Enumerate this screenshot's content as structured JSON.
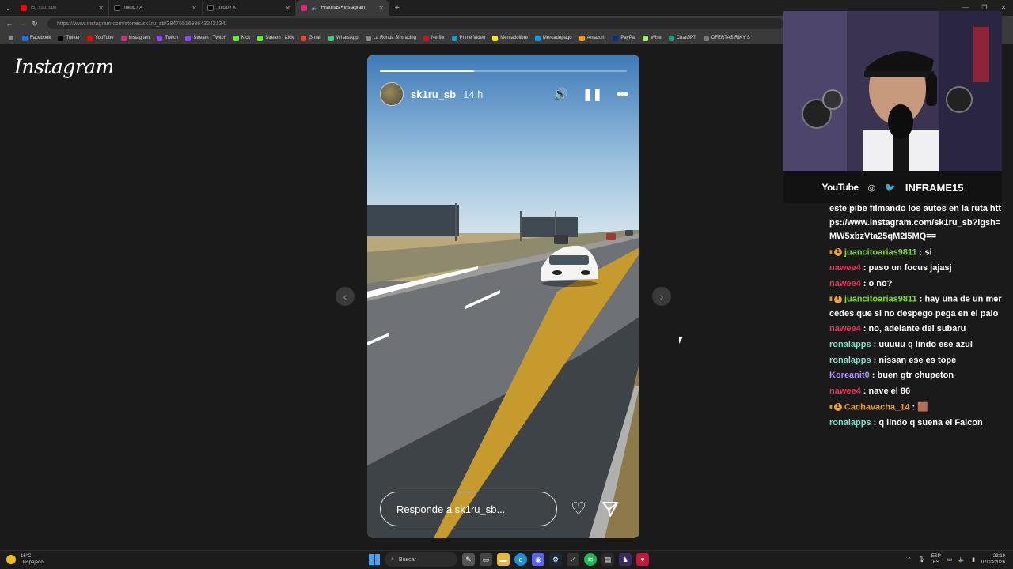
{
  "browser": {
    "tabs": [
      {
        "label": "(5) YouTube",
        "color": "#ff0000",
        "active": false
      },
      {
        "label": "Inicio / X",
        "color": "#000000",
        "active": false
      },
      {
        "label": "Inicio / X",
        "color": "#000000",
        "active": false
      },
      {
        "label": "Historias • Instagram",
        "color": "#d62976",
        "active": true
      }
    ],
    "url": "https://www.instagram.com/stories/sk1ru_sb/3847551693643242134/",
    "bookmarks": [
      {
        "label": "Facebook",
        "color": "#1877f2"
      },
      {
        "label": "Twitter",
        "color": "#000000"
      },
      {
        "label": "YouTube",
        "color": "#ff0000"
      },
      {
        "label": "Instagram",
        "color": "#d62976"
      },
      {
        "label": "Twitch",
        "color": "#9146ff"
      },
      {
        "label": "Stream - Twitch",
        "color": "#9146ff"
      },
      {
        "label": "Kick",
        "color": "#53fc18"
      },
      {
        "label": "Stream - Kick",
        "color": "#53fc18"
      },
      {
        "label": "Gmail",
        "color": "#ea4335"
      },
      {
        "label": "WhatsApp",
        "color": "#25d366"
      },
      {
        "label": "La Ronda Simracing",
        "color": "#888888"
      },
      {
        "label": "Netflix",
        "color": "#e50914"
      },
      {
        "label": "Prime Video",
        "color": "#00a8e1"
      },
      {
        "label": "Mercadolibre",
        "color": "#ffe600"
      },
      {
        "label": "Mercadopago",
        "color": "#009ee3"
      },
      {
        "label": "Amazon.",
        "color": "#ff9900"
      },
      {
        "label": "PayPal",
        "color": "#003087"
      },
      {
        "label": "Wise",
        "color": "#9fe870"
      },
      {
        "label": "ChatGPT",
        "color": "#10a37f"
      },
      {
        "label": "OFERTAS RIKY S",
        "color": "#777777"
      }
    ]
  },
  "instagram": {
    "logo": "Instagram",
    "story": {
      "username": "sk1ru_sb",
      "time": "14 h",
      "progress": 0.38,
      "reply_placeholder": "Responde a sk1ru_sb..."
    }
  },
  "overlay": {
    "socials": {
      "youtube": "YouTube",
      "handle": "INFRAME15"
    },
    "chat": [
      {
        "user": "",
        "badge": "none",
        "color": "",
        "text": "este pibe filmando los autos en la ruta https://www.instagram.com/sk1ru_sb?igsh=MW5xbzVta25qM2I5MQ=="
      },
      {
        "user": "juancitoarias9811",
        "badge": "sub",
        "color": "u-green",
        "text": "si"
      },
      {
        "user": "nawee4",
        "badge": "none",
        "color": "u-red",
        "text": "paso un focus jajasj"
      },
      {
        "user": "nawee4",
        "badge": "none",
        "color": "u-red",
        "text": "o no?"
      },
      {
        "user": "juancitoarias9811",
        "badge": "sub",
        "color": "u-green",
        "text": "hay una de un mercedes que si no despego pega en el palo"
      },
      {
        "user": "nawee4",
        "badge": "none",
        "color": "u-red",
        "text": "no, adelante del subaru"
      },
      {
        "user": "ronalapps",
        "badge": "none",
        "color": "u-teal",
        "text": "uuuuu q lindo ese azul"
      },
      {
        "user": "ronalapps",
        "badge": "none",
        "color": "u-teal",
        "text": "nissan ese es tope"
      },
      {
        "user": "Koreanit0",
        "badge": "none",
        "color": "u-purple",
        "text": "buen gtr chupeton"
      },
      {
        "user": "nawee4",
        "badge": "none",
        "color": "u-red",
        "text": "nave el 86"
      },
      {
        "user": "Cachavacha_14",
        "badge": "sub",
        "color": "u-orange",
        "text": "🟫"
      },
      {
        "user": "ronalapps",
        "badge": "none",
        "color": "u-teal",
        "text": "q lindo q suena el Falcon"
      }
    ]
  },
  "taskbar": {
    "weather_temp": "16°C",
    "weather_desc": "Despejado",
    "search_label": "Buscar",
    "lang": "ESP",
    "lang2": "ES",
    "time": "23:19",
    "date": "07/03/2026"
  }
}
